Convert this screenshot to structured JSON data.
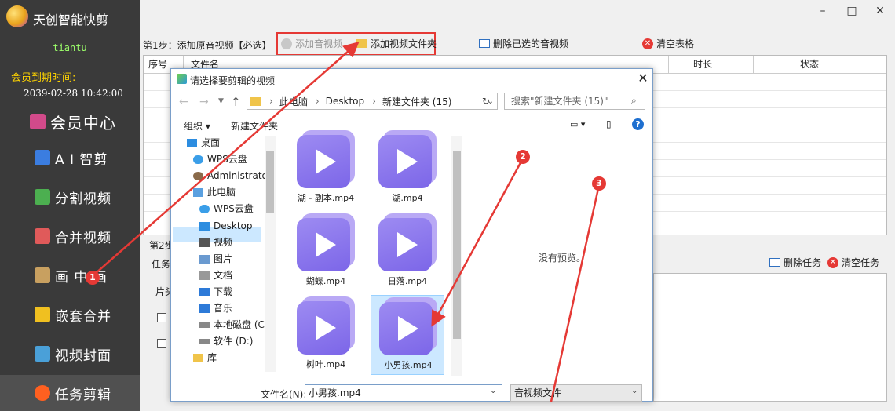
{
  "app": {
    "title": "天创智能快剪",
    "username": "tiantu",
    "expiry_label": "会员到期时间:",
    "expiry_date": "2039-02-28 10:42:00"
  },
  "sidebar": {
    "items": [
      {
        "label": "会员中心",
        "icon": "vip-icon",
        "color": "#d24a8a"
      },
      {
        "label": "A I 智剪",
        "icon": "ai-icon",
        "color": "#3b7de0"
      },
      {
        "label": "分割视频",
        "icon": "split-icon",
        "color": "#4caf50"
      },
      {
        "label": "合并视频",
        "icon": "merge-icon",
        "color": "#e05a5a"
      },
      {
        "label": "画 中 画",
        "icon": "pip-icon",
        "color": "#c8a060"
      },
      {
        "label": "嵌套合并",
        "icon": "nest-icon",
        "color": "#f0c020"
      },
      {
        "label": "视频封面",
        "icon": "cover-icon",
        "color": "#4aa0d8"
      },
      {
        "label": "任务剪辑",
        "icon": "flower-icon",
        "color": "#ff6020"
      }
    ]
  },
  "window": {
    "min": "–",
    "max": "□",
    "close": "✕"
  },
  "toolbar": {
    "step1": "第1步：添加原音视频【必选】",
    "add_av": "添加音视频",
    "add_folder": "添加视频文件夹",
    "delete_selected": "删除已选的音视频",
    "clear_table": "清空表格"
  },
  "table": {
    "columns": {
      "seq": "序号",
      "name": "文件名",
      "duration": "时长",
      "status": "状态"
    }
  },
  "step2": {
    "label": "第2步",
    "task_label": "任务",
    "clip_label": "片头",
    "delete_task": "删除任务",
    "clear_task": "清空任务"
  },
  "dialog": {
    "title": "请选择要剪辑的视频",
    "path": [
      "此电脑",
      "Desktop",
      "新建文件夹 (15)"
    ],
    "search_placeholder": "搜索\"新建文件夹 (15)\"",
    "organize": "组织 ▾",
    "new_folder": "新建文件夹",
    "tree": [
      {
        "label": "桌面",
        "icon": "desktop-icon",
        "indent": 0
      },
      {
        "label": "WPS云盘",
        "icon": "cloud-icon",
        "indent": 1
      },
      {
        "label": "Administrator",
        "icon": "user-icon",
        "indent": 1
      },
      {
        "label": "此电脑",
        "icon": "pc-icon",
        "indent": 1
      },
      {
        "label": "WPS云盘",
        "icon": "cloud-icon",
        "indent": 2
      },
      {
        "label": "Desktop",
        "icon": "desktop-icon",
        "indent": 2
      },
      {
        "label": "视频",
        "icon": "video-folder-icon",
        "indent": 2
      },
      {
        "label": "图片",
        "icon": "picture-folder-icon",
        "indent": 2
      },
      {
        "label": "文档",
        "icon": "document-folder-icon",
        "indent": 2
      },
      {
        "label": "下载",
        "icon": "download-icon",
        "indent": 2
      },
      {
        "label": "音乐",
        "icon": "music-icon",
        "indent": 2
      },
      {
        "label": "本地磁盘 (C:)",
        "icon": "drive-icon",
        "indent": 2
      },
      {
        "label": "软件 (D:)",
        "icon": "drive-icon",
        "indent": 2
      },
      {
        "label": "库",
        "icon": "library-icon",
        "indent": 1
      }
    ],
    "files": [
      {
        "name": "湖 - 副本.mp4",
        "selected": false
      },
      {
        "name": "湖.mp4",
        "selected": false
      },
      {
        "name": "蝴蝶.mp4",
        "selected": false
      },
      {
        "name": "日落.mp4",
        "selected": false
      },
      {
        "name": "树叶.mp4",
        "selected": false
      },
      {
        "name": "小男孩.mp4",
        "selected": true
      }
    ],
    "no_preview": "没有预览。",
    "filename_label": "文件名(N):",
    "filename_value": "小男孩.mp4",
    "filter": "音视频文件"
  },
  "annotations": {
    "badge1": "1",
    "badge2": "2",
    "badge3": "3",
    "color": "#e53935"
  }
}
